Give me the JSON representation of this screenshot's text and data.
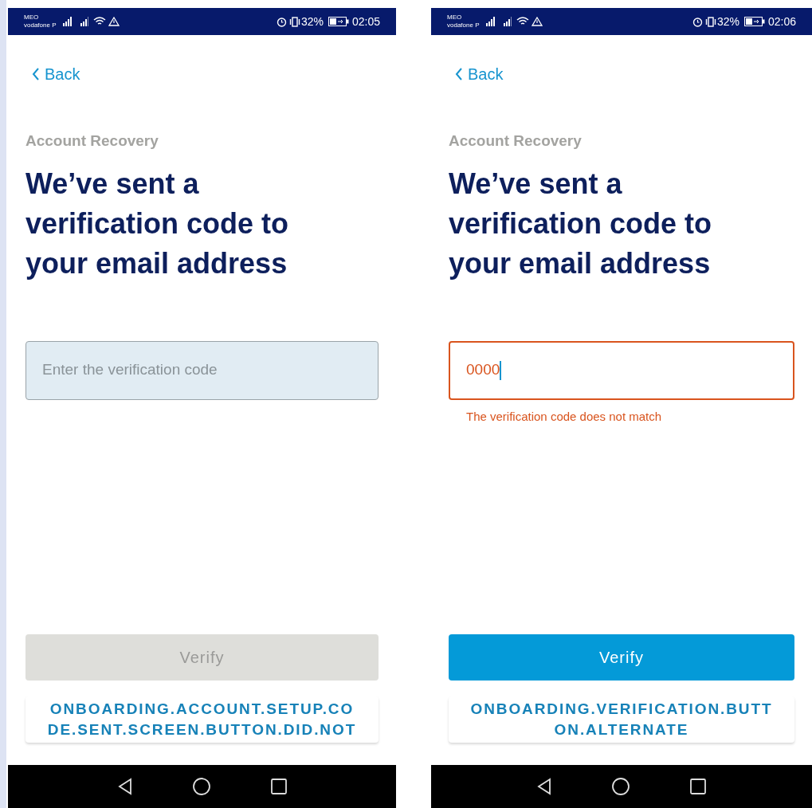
{
  "screens": [
    {
      "status_bar": {
        "carrier": "MEO",
        "network": "vodafone P",
        "battery": "32%",
        "time": "02:05"
      },
      "back": "Back",
      "eyebrow": "Account Recovery",
      "heading": "We’ve sent a verification code to your email address",
      "field": {
        "placeholder": "Enter the verification code",
        "error": false
      },
      "verify_button": {
        "label": "Verify",
        "disabled": true
      },
      "alternate_button": {
        "label": "ONBOARDING.ACCOUNT.SETUP.CODE.SENT.SCREEN.BUTTON.DID.NOT"
      }
    },
    {
      "status_bar": {
        "carrier": "MEO",
        "network": "vodafone P",
        "battery": "32%",
        "time": "02:06"
      },
      "back": "Back",
      "eyebrow": "Account Recovery",
      "heading": "We’ve sent a verification code to your email address",
      "field": {
        "value": "0000",
        "error": true
      },
      "error_message": "The verification code does not match",
      "verify_button": {
        "label": "Verify",
        "disabled": false
      },
      "alternate_button": {
        "label": "ONBOARDING.VERIFICATION.BUTTON.ALTERNATE"
      }
    }
  ]
}
